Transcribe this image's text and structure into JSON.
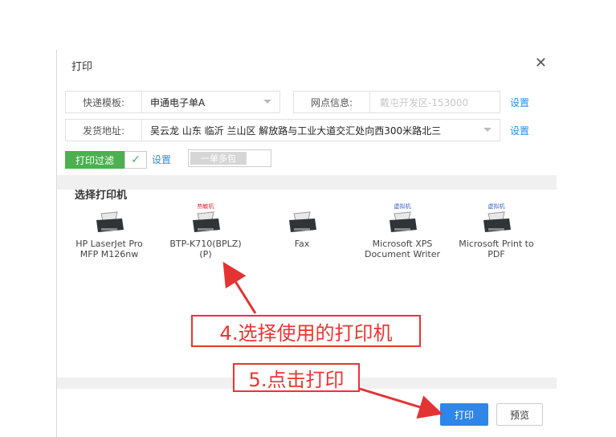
{
  "dialog": {
    "title": "打印",
    "close_glyph": "✕",
    "template_label": "快递模板:",
    "template_value": "申通电子单A",
    "branch_label": "网点信息:",
    "branch_value": "戴屯开发区-153000",
    "settings_link_1": "设置",
    "address_label": "发货地址:",
    "address_value": "吴云龙  山东 临沂 兰山区  解放路与工业大道交汇处向西300米路北三",
    "settings_link_2": "设置",
    "filter_button": "打印过滤",
    "filter_settings_link": "设置",
    "multi_toggle": "一单多包",
    "section_title": "选择打印机",
    "printers": [
      {
        "tag": "",
        "line1": "HP LaserJet Pro",
        "line2": "MFP M126nw"
      },
      {
        "tag": "热敏机",
        "line1": "BTP-K710(BPLZ)",
        "line2": "(P)"
      },
      {
        "tag": "",
        "line1": "Fax",
        "line2": ""
      },
      {
        "tag": "虚拟机",
        "line1": "Microsoft XPS",
        "line2": "Document Writer"
      },
      {
        "tag": "虚拟机",
        "line1": "Microsoft Print to",
        "line2": "PDF"
      }
    ],
    "print_button": "打印",
    "preview_button": "预览"
  },
  "annotations": {
    "step4": "4.选择使用的打印机",
    "step5": "5.点击打印"
  },
  "colors": {
    "accent": "#2d86e8",
    "filter_green": "#4caf50",
    "annotation_red": "#e33333"
  }
}
